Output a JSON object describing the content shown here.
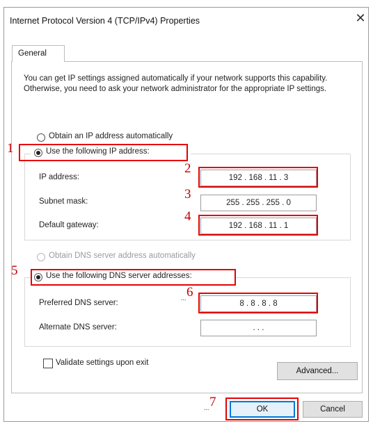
{
  "window": {
    "title": "Internet Protocol Version 4 (TCP/IPv4) Properties",
    "close_glyph": "✕"
  },
  "tabs": [
    {
      "label": "General",
      "selected": true
    }
  ],
  "description": "You can get IP settings assigned automatically if your network supports this capability. Otherwise, you need to ask your network administrator for the appropriate IP settings.",
  "ip_section": {
    "auto_label": "Obtain an IP address automatically",
    "manual_label": "Use the following IP address:",
    "selected": "manual",
    "fields": [
      {
        "label": "IP address:",
        "value": "192 . 168 . 11 . 3"
      },
      {
        "label": "Subnet mask:",
        "value": "255 . 255 . 255 . 0"
      },
      {
        "label": "Default gateway:",
        "value": "192 . 168 . 11 . 1"
      }
    ]
  },
  "dns_section": {
    "auto_label": "Obtain DNS server address automatically",
    "manual_label": "Use the following DNS server addresses:",
    "selected": "manual",
    "fields": [
      {
        "label": "Preferred DNS server:",
        "value": "8 . 8 . 8 . 8"
      },
      {
        "label": "Alternate DNS server:",
        "value": ". . ."
      }
    ]
  },
  "validate_label": "Validate settings upon exit",
  "validate_checked": false,
  "buttons": {
    "advanced": "Advanced...",
    "ok": "OK",
    "cancel": "Cancel"
  },
  "annotations": {
    "n1": "1",
    "n2": "2",
    "n3": "3",
    "n4": "4",
    "n5": "5",
    "n6": "6",
    "n7": "7",
    "dots6": "...",
    "dots7": "...",
    "highlight_color": "#e60000"
  }
}
